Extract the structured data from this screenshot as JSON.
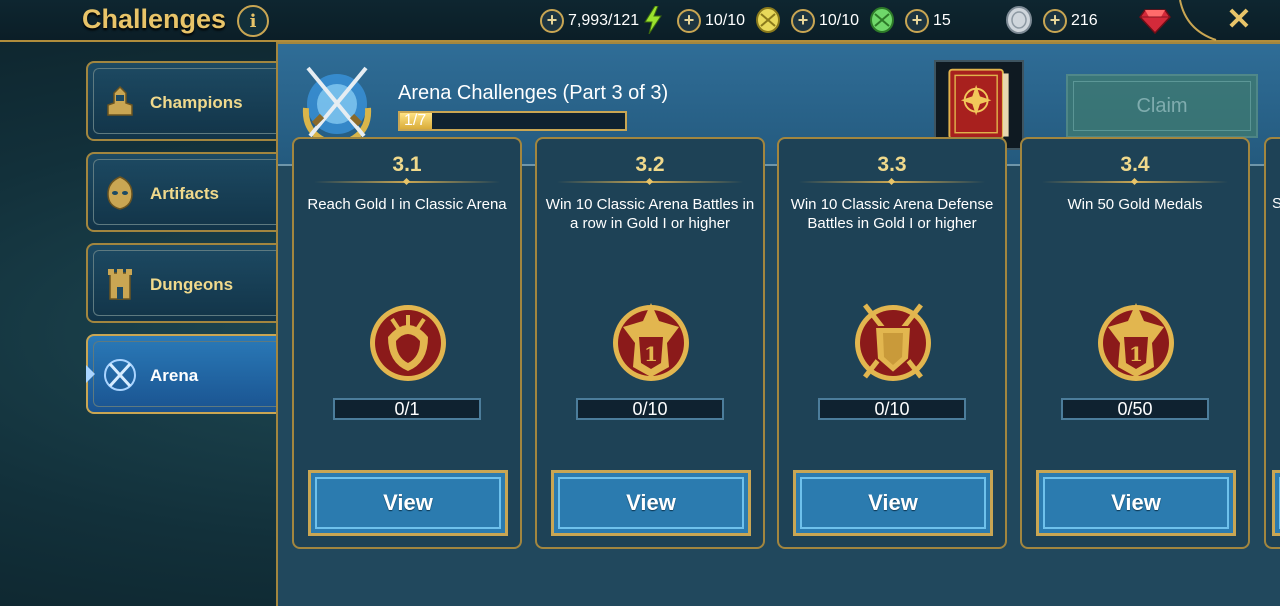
{
  "header": {
    "title": "Challenges",
    "info_label": "i",
    "close_label": "✕"
  },
  "resources": [
    {
      "name": "energy",
      "value": "7,993/121",
      "icon": "lightning-icon"
    },
    {
      "name": "classic-arena-tokens",
      "value": "10/10",
      "icon": "yellow-token-icon"
    },
    {
      "name": "tag-arena-tokens",
      "value": "10/10",
      "icon": "green-token-icon"
    },
    {
      "name": "silver",
      "value": "15",
      "icon": "silver-coin-icon"
    },
    {
      "name": "gems",
      "value": "216",
      "icon": "ruby-gem-icon"
    }
  ],
  "sidebar": {
    "items": [
      {
        "label": "Champions",
        "icon": "champion-helmet-icon",
        "active": false
      },
      {
        "label": "Artifacts",
        "icon": "artifact-mask-icon",
        "active": false
      },
      {
        "label": "Dungeons",
        "icon": "dungeon-tower-icon",
        "active": false
      },
      {
        "label": "Arena",
        "icon": "crossed-swords-icon",
        "active": true
      }
    ]
  },
  "challenge": {
    "title": "Arena Challenges (Part 3 of 3)",
    "progress_text": "1/7",
    "progress_fraction": 0.143,
    "reward_icon": "red-book-icon",
    "claim_label": "Claim"
  },
  "cards": [
    {
      "number": "3.1",
      "description": "Reach Gold I in Classic Arena",
      "progress": "0/1",
      "medal": "gold-crest-medal-icon",
      "view_label": "View"
    },
    {
      "number": "3.2",
      "description": "Win 10 Classic Arena Battles in a row in Gold I or higher",
      "progress": "0/10",
      "medal": "gold-one-medal-icon",
      "view_label": "View"
    },
    {
      "number": "3.3",
      "description": "Win 10 Classic Arena Defense Battles in Gold I or higher",
      "progress": "0/10",
      "medal": "shield-swords-medal-icon",
      "view_label": "View"
    },
    {
      "number": "3.4",
      "description": "Win 50 Gold Medals",
      "progress": "0/50",
      "medal": "gold-one-medal-icon",
      "view_label": "View"
    },
    {
      "peek_text": "S"
    }
  ],
  "colors": {
    "gold": "#c9a653",
    "title_gold": "#e8c469",
    "active_tab": "#2a7ab8",
    "view_button": "#2b7baf",
    "medal_red": "#8b1a1a"
  }
}
